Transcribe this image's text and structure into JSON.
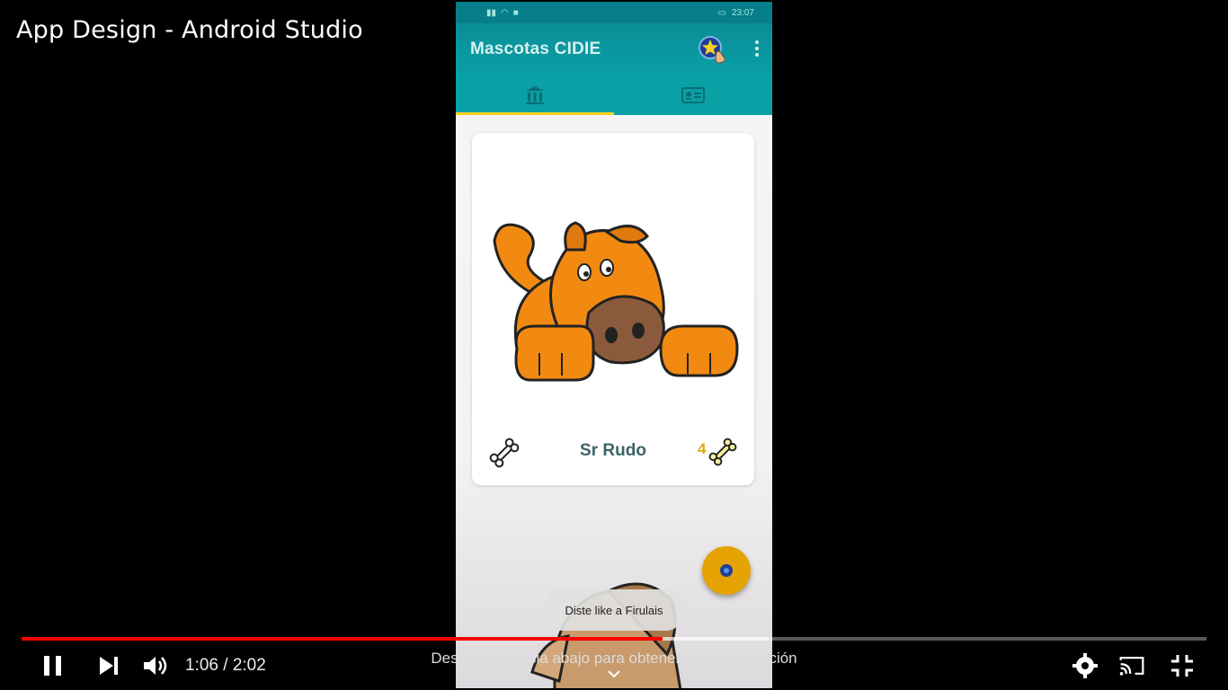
{
  "video": {
    "title": "App Design - Android Studio",
    "current_time": "1:06",
    "duration": "2:02",
    "time_display": "1:06 / 2:02",
    "progress_percent": 54.1,
    "buffered_percent": 63,
    "scroll_hint": "Desplázate hacia abajo para obtener más información"
  },
  "phone": {
    "status_time": "23:07",
    "app_title": "Mascotas CIDIE",
    "tabs": [
      {
        "icon": "institution-icon",
        "selected": true
      },
      {
        "icon": "id-card-icon",
        "selected": false
      }
    ],
    "card": {
      "pet_name": "Sr Rudo",
      "likes": "4"
    },
    "toast": "Diste like a Firulais"
  },
  "colors": {
    "appbar": "#09a0a6",
    "tab_indicator": "#f3d11c",
    "fab": "#e4a302",
    "progress_played": "#ff0000"
  }
}
